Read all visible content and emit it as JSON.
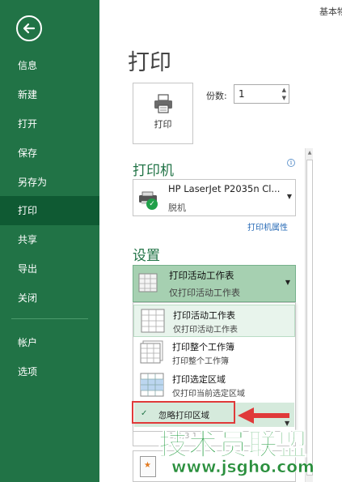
{
  "doc_title": "基本物",
  "sidebar": {
    "items": [
      {
        "label": "信息"
      },
      {
        "label": "新建"
      },
      {
        "label": "打开"
      },
      {
        "label": "保存"
      },
      {
        "label": "另存为"
      },
      {
        "label": "打印"
      },
      {
        "label": "共享"
      },
      {
        "label": "导出"
      },
      {
        "label": "关闭"
      },
      {
        "label": "帐户"
      },
      {
        "label": "选项"
      }
    ],
    "active_index": 5
  },
  "page_title": "打印",
  "print_button_label": "打印",
  "copies": {
    "label": "份数:",
    "value": "1"
  },
  "printer": {
    "heading": "打印机",
    "name": "HP LaserJet P2035n Cl...",
    "status": "脱机",
    "properties_link": "打印机属性"
  },
  "settings": {
    "heading": "设置",
    "selected": {
      "title": "打印活动工作表",
      "subtitle": "仅打印活动工作表"
    },
    "menu": [
      {
        "title": "打印活动工作表",
        "subtitle": "仅打印活动工作表"
      },
      {
        "title": "打印整个工作簿",
        "subtitle": "打印整个工作簿"
      },
      {
        "title": "打印选定区域",
        "subtitle": "仅打印当前选定区域"
      }
    ],
    "ignore_print_area": "忽略打印区域",
    "lower_partial": "1,2,3 1,2,3"
  },
  "watermark": {
    "text": "技术员联盟",
    "url": "www.jsgho.com"
  },
  "colors": {
    "sidebar": "#217346",
    "accent": "#217346",
    "highlight": "#a6d0b1",
    "annotation": "#e03a3a"
  }
}
